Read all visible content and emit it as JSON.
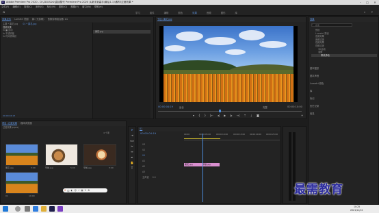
{
  "title": {
    "app_logo": "Pr",
    "text": "Adobe Premiere Pro 2020 - D:\\ZDGSDG\\直接替代 Premiere Pro 2020 从新手到高手(最后1.1)\\素材\\过渡效果 *"
  },
  "window_controls": {
    "minimize": "–",
    "maximize": "□",
    "close": "✕"
  },
  "menu": [
    "文件(F)",
    "编辑(E)",
    "剪辑(C)",
    "序列(S)",
    "标记(M)",
    "图形(G)",
    "视图(V)",
    "窗口(W)",
    "帮助(H)"
  ],
  "workspaces": {
    "tabs": [
      "学习",
      "组件",
      "编辑",
      "颜色",
      "效果",
      "音频",
      "图形",
      "库"
    ],
    "active": "效果"
  },
  "source_panel": {
    "tabs": [
      "效果控件",
      "Lumetri 范围",
      "源: (无剪辑)",
      "音频剪辑混合器: 01"
    ],
    "active": "效果控件",
    "header": "主要 * 果花.jpg",
    "clip_link": "01 * 果花.jpg",
    "rows": [
      "视频效果",
      "fx ■ 运动",
      "fx 不透明度",
      "fx 时间重映射"
    ],
    "clip_label": "果花.jpg",
    "timecode": "00:00:04:13"
  },
  "program_monitor": {
    "title": "节目: 果花.jpg",
    "timecode_current": "00:00:04:19",
    "fit": "适合",
    "quality": "完整",
    "timecode_total": "00:00:10:00",
    "scrubber_fraction": 0.43
  },
  "effects_panel": {
    "title": "效果",
    "search_placeholder": "搜索",
    "items": [
      "预设",
      "Lumetri 预设",
      "音频效果",
      "音频过渡",
      "视频效果",
      "视频过渡",
      "3D运动",
      "溶解",
      "带状滑动"
    ],
    "sections": [
      "基本图形",
      "基本声音",
      "Lumetri 颜色",
      "库",
      "标记",
      "历史记录",
      "信息"
    ]
  },
  "project_panel": {
    "tabs": [
      "项目: 过渡效果",
      "媒体浏览器"
    ],
    "project_file": "过渡效果.prproj",
    "items_count": "4 个项",
    "items": [
      {
        "name": "果花.jpg",
        "duration": "5:00"
      },
      {
        "name": "早餐.jpg",
        "duration": "5:00"
      },
      {
        "name": "早餐.jpg",
        "duration": "5:00"
      },
      {
        "name": "01",
        "duration": "10:00"
      }
    ]
  },
  "timeline": {
    "title": "01",
    "timecode": "00:00:04:19",
    "ruler": [
      "00:00",
      "00:00:05:00",
      "00:00:10:00",
      "00:00:15:00",
      "00:00:20:00",
      "00:00:25:00"
    ],
    "tracks": [
      "V3",
      "V2",
      "V1",
      "A1",
      "A2",
      "A3"
    ],
    "master": "主声道",
    "master_value": "0.0",
    "clips": [
      {
        "label": "果花.jpg",
        "track": "V1"
      },
      {
        "label": "早餐.jpg",
        "track": "V1"
      }
    ],
    "playhead_fraction": 0.19
  },
  "watermark": "最需教育",
  "taskbar": {
    "time": "10:25",
    "date": "2021/11/12"
  }
}
